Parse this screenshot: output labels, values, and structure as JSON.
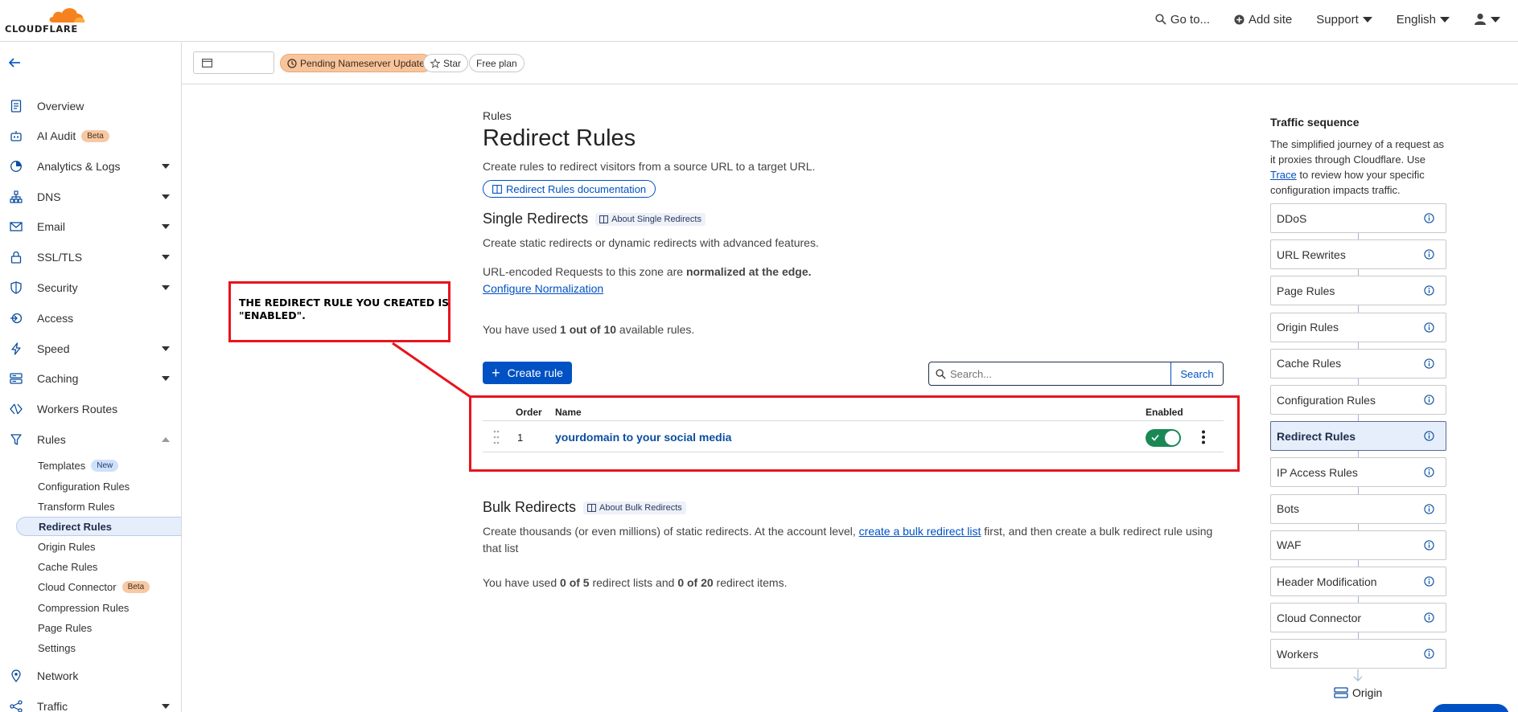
{
  "header": {
    "logo_text": "CLOUDFLARE",
    "goto_label": "Go to...",
    "add_site_label": "Add site",
    "support_label": "Support",
    "language_label": "English"
  },
  "zonebar": {
    "status_badge": "Pending Nameserver Update",
    "star_label": "Star",
    "plan_label": "Free plan"
  },
  "sidebar": {
    "items": [
      {
        "label": "Overview",
        "icon": "document-icon"
      },
      {
        "label": "AI Audit",
        "icon": "robot-icon",
        "badge": "Beta"
      },
      {
        "label": "Analytics & Logs",
        "icon": "chart-icon"
      },
      {
        "label": "DNS",
        "icon": "network-tree-icon"
      },
      {
        "label": "Email",
        "icon": "envelope-icon"
      },
      {
        "label": "SSL/TLS",
        "icon": "lock-icon"
      },
      {
        "label": "Security",
        "icon": "shield-icon"
      },
      {
        "label": "Access",
        "icon": "access-icon"
      },
      {
        "label": "Speed",
        "icon": "lightning-icon"
      },
      {
        "label": "Caching",
        "icon": "server-icon"
      },
      {
        "label": "Workers Routes",
        "icon": "workers-icon"
      },
      {
        "label": "Rules",
        "icon": "funnel-icon"
      },
      {
        "label": "Network",
        "icon": "location-pin-icon"
      },
      {
        "label": "Traffic",
        "icon": "share-icon"
      }
    ],
    "rules_sub": [
      {
        "label": "Templates",
        "badge": "New"
      },
      {
        "label": "Configuration Rules"
      },
      {
        "label": "Transform Rules"
      },
      {
        "label": "Redirect Rules"
      },
      {
        "label": "Origin Rules"
      },
      {
        "label": "Cache Rules"
      },
      {
        "label": "Cloud Connector",
        "badge": "Beta"
      },
      {
        "label": "Compression Rules"
      },
      {
        "label": "Page Rules"
      },
      {
        "label": "Settings"
      }
    ]
  },
  "main": {
    "breadcrumb": "Rules",
    "title": "Redirect Rules",
    "description": "Create rules to redirect visitors from a source URL to a target URL.",
    "doc_button": "Redirect Rules documentation",
    "single": {
      "title": "Single Redirects",
      "tag": "About Single Redirects",
      "description": "Create static redirects or dynamic redirects with advanced features.",
      "normalized_prefix": "URL-encoded Requests to this zone are ",
      "normalized_bold": "normalized at the edge.",
      "normalization_link": "Configure Normalization",
      "usage_prefix": "You have used ",
      "usage_bold": "1 out of 10",
      "usage_suffix": " available rules."
    },
    "create_button": "Create rule",
    "search": {
      "placeholder": "Search...",
      "button": "Search"
    },
    "table": {
      "headers": {
        "order": "Order",
        "name": "Name",
        "enabled": "Enabled"
      },
      "rows": [
        {
          "order": "1",
          "name": "yourdomain to your social media",
          "enabled": true
        }
      ]
    },
    "bulk": {
      "title": "Bulk Redirects",
      "tag": "About Bulk Redirects",
      "desc_prefix": "Create thousands (or even millions) of static redirects. At the account level, ",
      "desc_link": "create a bulk redirect list",
      "desc_suffix": " first, and then create a bulk redirect rule using that list",
      "usage_prefix": "You have used ",
      "usage_lists": "0 of 5",
      "usage_mid": " redirect lists and ",
      "usage_items": "0 of 20",
      "usage_suffix": " redirect items."
    }
  },
  "annotation": {
    "text": "THE REDIRECT RULE YOU CREATED IS\n\"ENABLED\".",
    "color": "#e8141e"
  },
  "traffic": {
    "title": "Traffic sequence",
    "desc_prefix": "The simplified journey of a request as it proxies through Cloudflare. Use ",
    "desc_link": "Trace",
    "desc_suffix": " to review how your specific configuration impacts traffic.",
    "steps": [
      "DDoS",
      "URL Rewrites",
      "Page Rules",
      "Origin Rules",
      "Cache Rules",
      "Configuration Rules",
      "Redirect Rules",
      "IP Access Rules",
      "Bots",
      "WAF",
      "Header Modification",
      "Cloud Connector",
      "Workers"
    ],
    "active_step": "Redirect Rules",
    "origin_label": "Origin"
  },
  "colors": {
    "accent": "#0051c3",
    "brand_orange": "#f6821f",
    "enabled_green": "#198855"
  }
}
